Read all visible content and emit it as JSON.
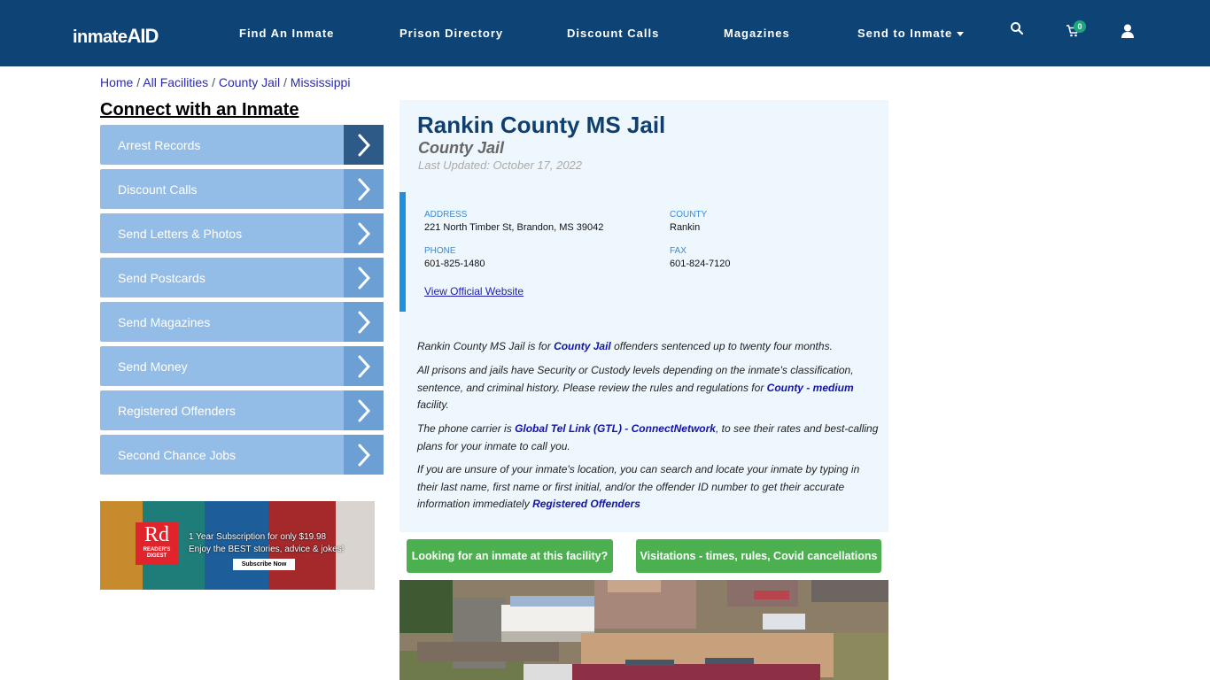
{
  "header": {
    "logo_part1": "inmate",
    "logo_part2": "AID",
    "nav": [
      {
        "label": "Find An Inmate"
      },
      {
        "label": "Prison Directory"
      },
      {
        "label": "Discount Calls"
      },
      {
        "label": "Magazines"
      },
      {
        "label": "Send to Inmate",
        "has_dropdown": true
      }
    ],
    "icons": [
      "search-icon",
      "cart-icon",
      "user-icon"
    ],
    "cart_count": "0"
  },
  "breadcrumb": {
    "items": [
      "Home",
      "All Facilities",
      "County Jail",
      "Mississippi"
    ],
    "separator": "/"
  },
  "sidebar": {
    "title": "Connect with an Inmate",
    "items": [
      {
        "label": "Arrest Records"
      },
      {
        "label": "Discount Calls"
      },
      {
        "label": "Send Letters & Photos"
      },
      {
        "label": "Send Postcards"
      },
      {
        "label": "Send Magazines"
      },
      {
        "label": "Send Money"
      },
      {
        "label": "Registered Offenders"
      },
      {
        "label": "Second Chance Jobs"
      }
    ],
    "ad": {
      "brand_big": "Rd",
      "brand_small1": "READER'S",
      "brand_small2": "DIGEST",
      "line1": "1 Year Subscription for only $19.98",
      "line2": "Enjoy the BEST stories, advice & jokes!",
      "cta": "Subscribe Now"
    }
  },
  "facility": {
    "name": "Rankin County MS Jail",
    "type": "County Jail",
    "last_updated": "Last Updated: October 17, 2022",
    "address_label": "ADDRESS",
    "address": "221 North Timber St, Brandon, MS 39042",
    "county_label": "COUNTY",
    "county": "Rankin",
    "phone_label": "PHONE",
    "phone": "601-825-1480",
    "fax_label": "FAX",
    "fax": "601-824-7120",
    "website_link": "View Official Website",
    "desc": {
      "p1_a": "Rankin County MS Jail is for ",
      "p1_link": "County Jail",
      "p1_b": " offenders sentenced up to twenty four months.",
      "p2_a": "All prisons and jails have Security or Custody levels depending on the inmate's classification, sentence, and criminal history. Please review the rules and regulations for ",
      "p2_link": "County - medium",
      "p2_b": " facility.",
      "p3_a": "The phone carrier is ",
      "p3_link": "Global Tel Link (GTL) - ConnectNetwork",
      "p3_b": ", to see their rates and best-calling plans for your inmate to call you.",
      "p4_a": "If you are unsure of your inmate's location, you can search and locate your inmate by typing in their last name, first name or first initial, and/or the offender ID number to get their accurate information immediately ",
      "p4_link": "Registered Offenders"
    },
    "buttons": {
      "find": "Looking for an inmate at this facility?",
      "visit": "Visitations - times, rules, Covid cancellations"
    }
  },
  "colors": {
    "header_bg": "#0e4376",
    "sidebar_item": "#93bde7",
    "sidebar_arrow": "#6c9fd4",
    "accent_green": "#4caf50",
    "link": "#1414a8"
  }
}
